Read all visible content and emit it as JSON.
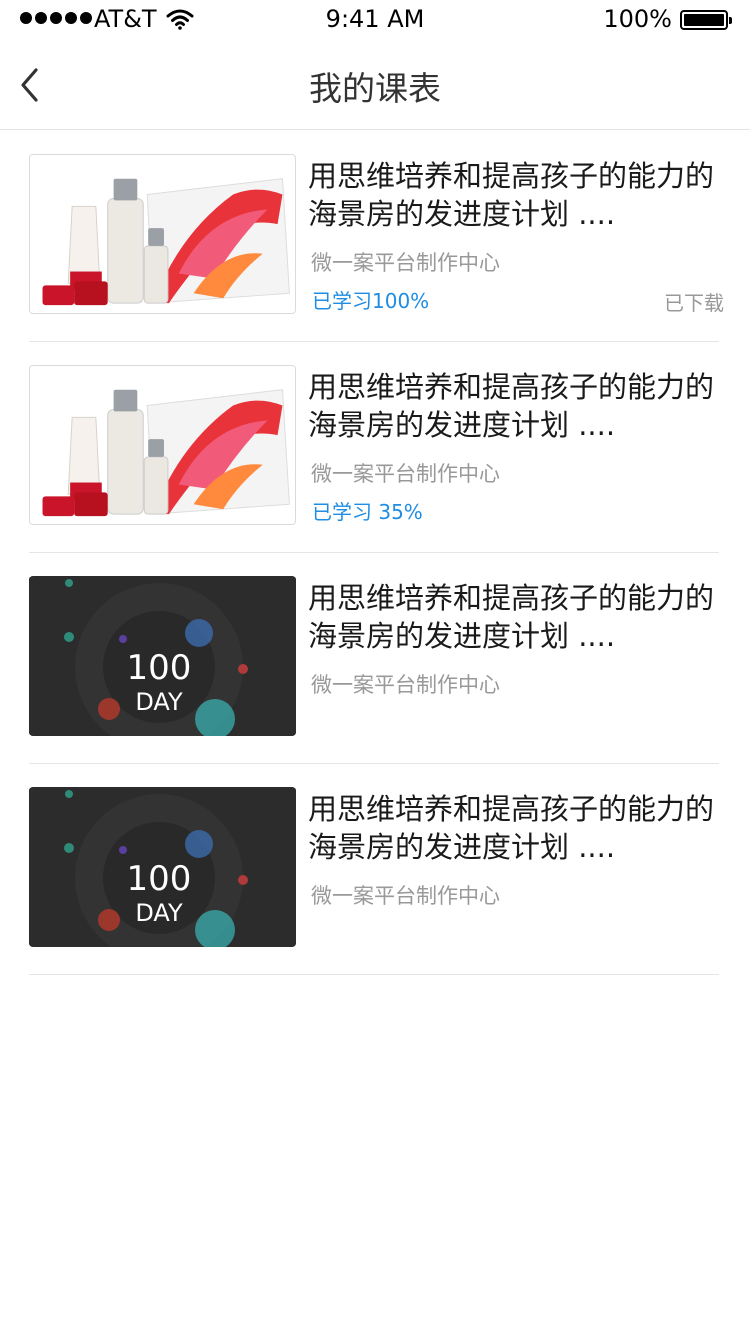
{
  "status_bar": {
    "carrier": "AT&T",
    "time": "9:41 AM",
    "battery": "100%"
  },
  "nav": {
    "title": "我的课表"
  },
  "courses": [
    {
      "thumbnail": "skincare-product-image",
      "title": "用思维培养和提高孩子的能力的海景房的发进度计划 ....",
      "source": "微一案平台制作中心",
      "progress": "已学习100%",
      "status": "已下载"
    },
    {
      "thumbnail": "skincare-product-image",
      "title": "用思维培养和提高孩子的能力的海景房的发进度计划 ....",
      "source": "微一案平台制作中心",
      "progress": "已学习 35%"
    },
    {
      "thumbnail": "100-day-image",
      "thumbnail_text": [
        "100",
        "DAY"
      ],
      "title": "用思维培养和提高孩子的能力的海景房的发进度计划 ....",
      "source": "微一案平台制作中心"
    },
    {
      "thumbnail": "100-day-image",
      "thumbnail_text": [
        "100",
        "DAY"
      ],
      "title": "用思维培养和提高孩子的能力的海景房的发进度计划 ....",
      "source": "微一案平台制作中心"
    }
  ],
  "colors": {
    "progress": "#1e8de3",
    "secondary_text": "#999999",
    "divider": "#e5e5e5"
  }
}
